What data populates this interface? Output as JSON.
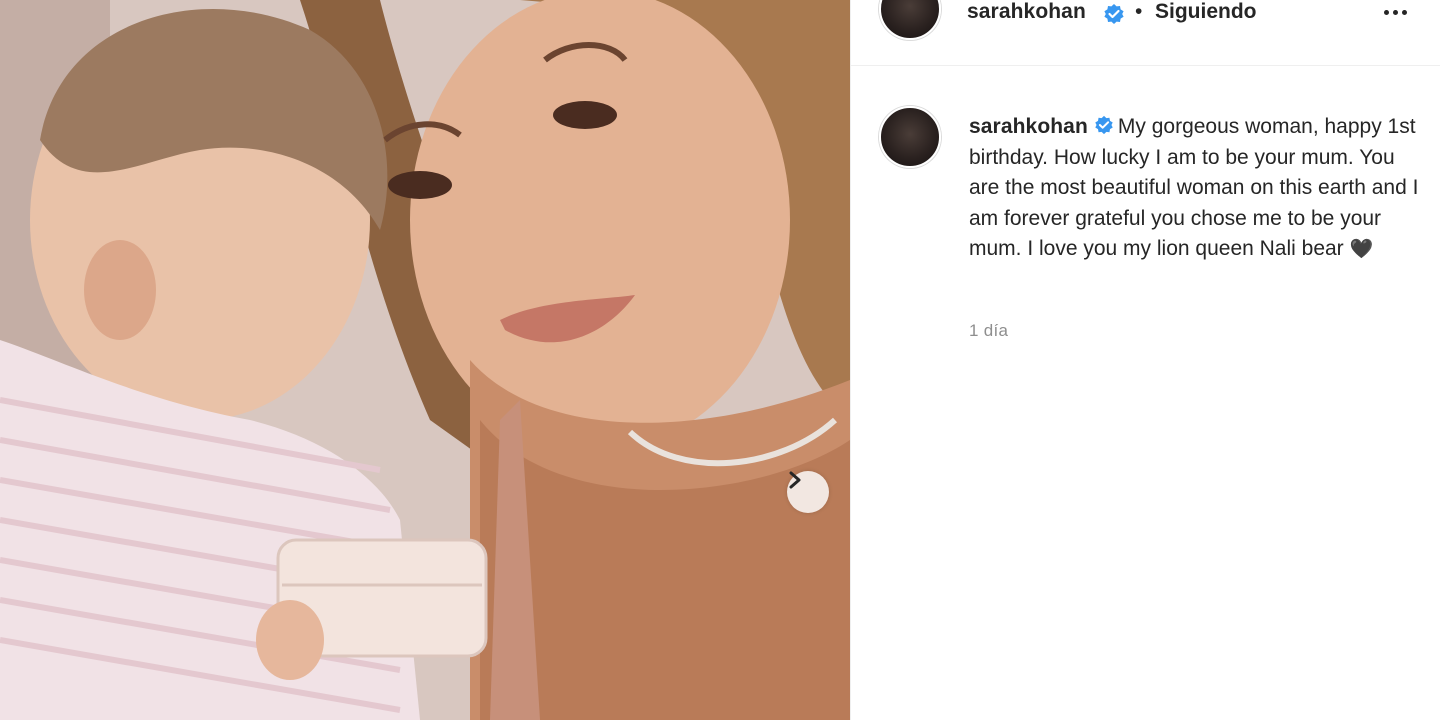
{
  "post": {
    "username": "sarahkohan",
    "separator": "•",
    "follow_status": "Siguiendo",
    "caption": "My gorgeous woman, happy 1st birthday. How lucky I am to be your mum. You are the most beautiful woman on this earth and I am forever grateful you chose me to be your mum. I love you my lion queen Nali bear",
    "caption_emoji": "🖤",
    "timestamp": "1 día"
  },
  "colors": {
    "verified": "#3897f0",
    "text": "#262626",
    "muted": "#8e8e8e"
  },
  "icons": {
    "verified": "verified-badge-icon",
    "more": "more-options-icon",
    "next": "chevron-right-icon"
  }
}
